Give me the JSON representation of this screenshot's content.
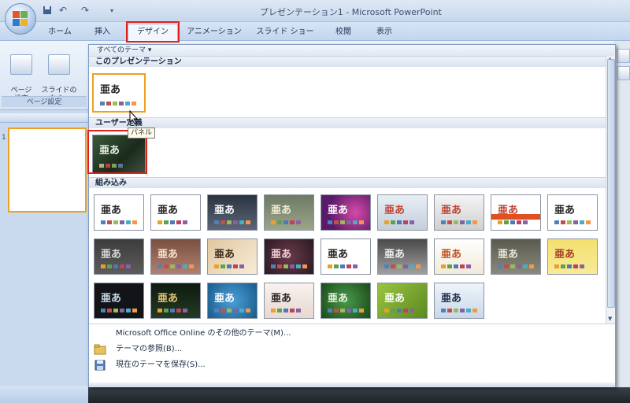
{
  "window": {
    "title": "プレゼンテーション1 - Microsoft PowerPoint"
  },
  "tabs": [
    {
      "label": "ホーム"
    },
    {
      "label": "挿入"
    },
    {
      "label": "デザイン"
    },
    {
      "label": "アニメーション"
    },
    {
      "label": "スライド ショー"
    },
    {
      "label": "校閲"
    },
    {
      "label": "表示"
    }
  ],
  "active_tab": "デザイン",
  "ribbon": {
    "page_setup_label": "ページ\n設定",
    "slide_orientation_label": "スライドの\n向き ▾",
    "group_label": "ページ設定"
  },
  "slide_panel": {
    "slide_number": "1"
  },
  "dropdown": {
    "header": "すべてのテーマ ▾",
    "sections": {
      "this_presentation": "このプレゼンテーション",
      "custom": "ユーザー定義",
      "builtin": "組み込み"
    },
    "theme_glyph": "亜あ",
    "tooltip": "パネル",
    "footer_items": [
      {
        "label": "Microsoft Office Online のその他のテーマ(M)..."
      },
      {
        "label": "テーマの参照(B)..."
      },
      {
        "label": "現在のテーマを保存(S)..."
      }
    ]
  },
  "colors": {
    "highlight_red": "#e0201a",
    "selection_orange": "#f0a020"
  },
  "icons": [
    "save-icon",
    "undo-icon",
    "redo-icon",
    "customize-qat-icon",
    "office-logo-icon",
    "cursor-icon",
    "browse-themes-icon",
    "save-theme-icon"
  ]
}
